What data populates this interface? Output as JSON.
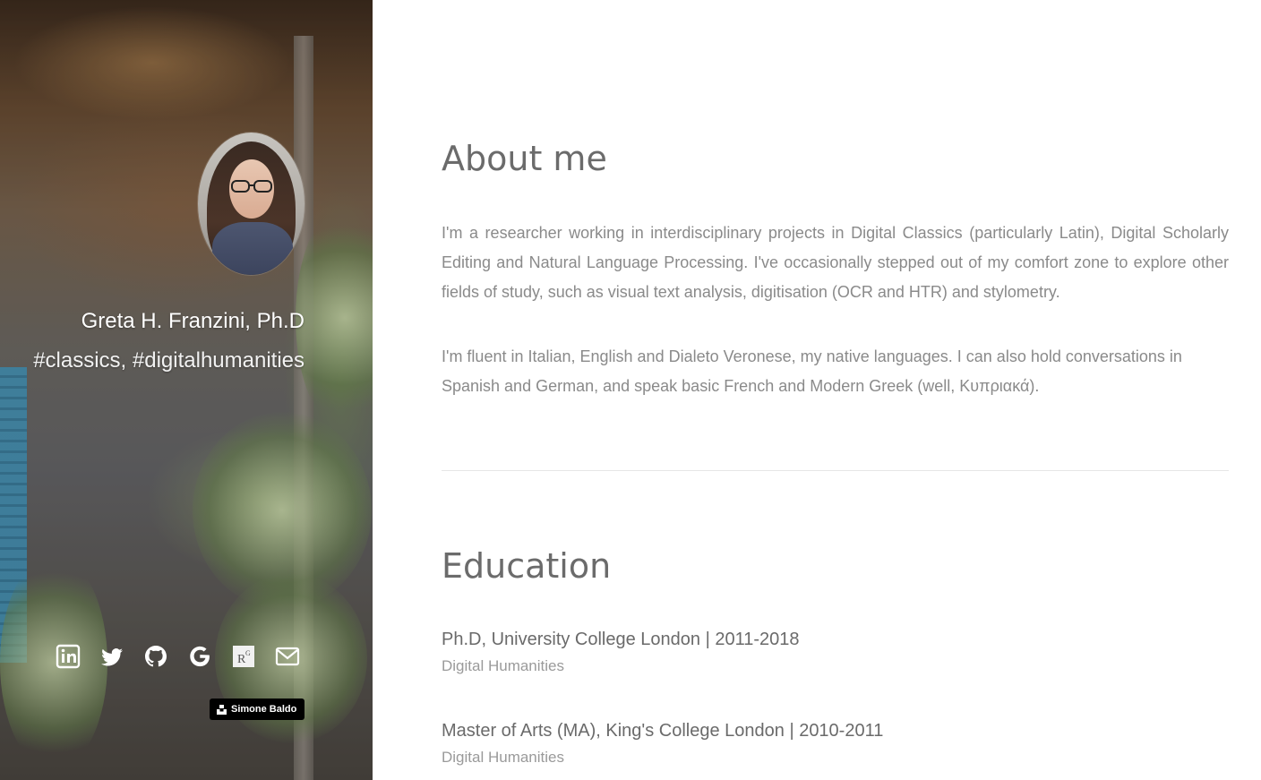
{
  "sidebar": {
    "name": "Greta H. Franzini, Ph.D",
    "tags": "#classics, #digitalhumanities",
    "social_icons": [
      "linkedin-icon",
      "twitter-icon",
      "github-icon",
      "google-icon",
      "researchgate-icon",
      "email-icon"
    ],
    "credit": "Simone Baldo"
  },
  "about": {
    "title": "About me",
    "paragraph1": "I'm a researcher working in interdisciplinary projects in Digital Classics (particularly Latin), Digital Scholarly Editing and Natural Language Processing. I've occasionally stepped out of my comfort zone to explore other fields of study, such as visual text analysis, digitisation (OCR and HTR) and stylometry.",
    "paragraph2": "I'm fluent in Italian, English and Dialeto Veronese, my native languages. I can also hold conversations in Spanish and German, and speak basic French and Modern Greek (well, Κυπριακά)."
  },
  "education": {
    "title": "Education",
    "items": [
      {
        "degree": "Ph.D, University College London | 2011-2018",
        "field": "Digital Humanities"
      },
      {
        "degree": "Master of Arts (MA), King's College London | 2010-2011",
        "field": "Digital Humanities"
      }
    ]
  },
  "colors": {
    "heading": "#6b6b6b",
    "body_text": "#8a8a8a",
    "divider": "#e6e6e6",
    "credit_bg": "#000000"
  }
}
